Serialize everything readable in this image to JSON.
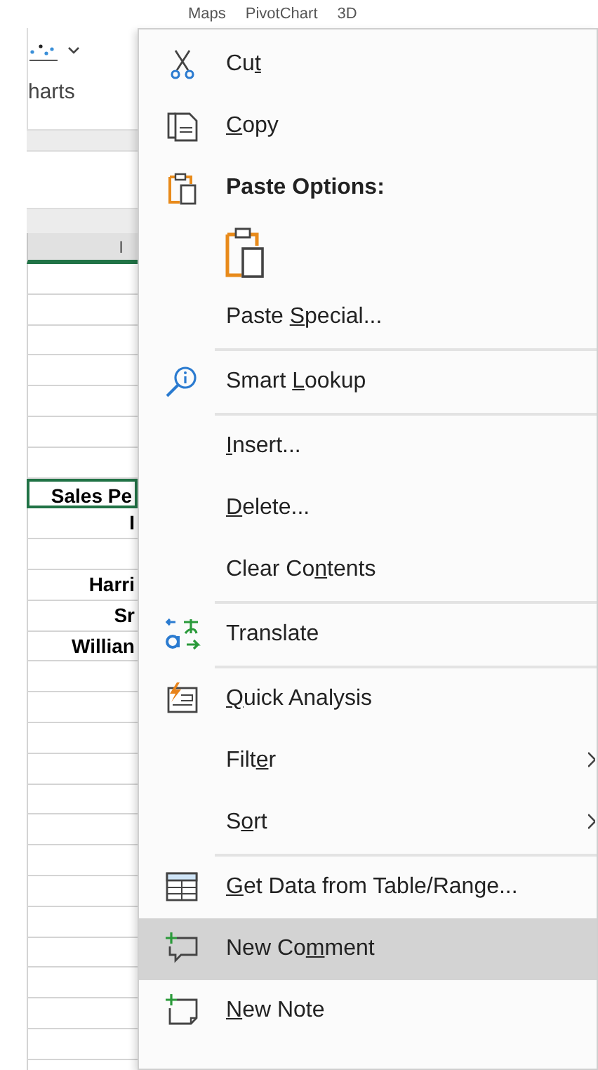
{
  "ribbon": {
    "top_labels": [
      "Maps",
      "PivotChart",
      "3D"
    ],
    "group_label": "harts"
  },
  "sheet": {
    "column_header": "I",
    "rows": [
      {
        "selected": false
      },
      {
        "selected": false
      },
      {
        "selected": false
      },
      {
        "selected": false
      },
      {
        "selected": false
      },
      {
        "selected": false
      },
      {
        "selected": false
      },
      {
        "value": "Sales Pe",
        "bold": true,
        "selected": true
      },
      {
        "value": "I",
        "bold": true,
        "selected": false
      },
      {
        "selected": false
      },
      {
        "value": "Harri",
        "bold": true,
        "selected": false
      },
      {
        "value": "Sr",
        "bold": true,
        "selected": false
      },
      {
        "value": "Willian",
        "bold": true,
        "selected": false
      },
      {
        "selected": false
      },
      {
        "selected": false
      },
      {
        "selected": false
      },
      {
        "selected": false
      },
      {
        "selected": false
      },
      {
        "selected": false
      },
      {
        "selected": false
      },
      {
        "selected": false
      },
      {
        "selected": false
      },
      {
        "selected": false
      },
      {
        "selected": false
      },
      {
        "selected": false
      },
      {
        "selected": false
      },
      {
        "selected": false
      }
    ]
  },
  "context_menu": {
    "items": [
      {
        "kind": "item",
        "before": "Cu",
        "key": "t",
        "selected": false
      },
      {
        "kind": "item",
        "key": "C",
        "after": "opy",
        "selected": false
      },
      {
        "kind": "heading",
        "label": "Paste Options:"
      },
      {
        "kind": "paste-option"
      },
      {
        "kind": "item",
        "before": "Paste ",
        "key": "S",
        "after": "pecial...",
        "selected": false
      },
      {
        "kind": "separator"
      },
      {
        "kind": "item",
        "before": "Smart ",
        "key": "L",
        "after": "ookup",
        "selected": false
      },
      {
        "kind": "separator"
      },
      {
        "kind": "item",
        "key": "I",
        "after": "nsert...",
        "selected": false
      },
      {
        "kind": "item",
        "key": "D",
        "after": "elete...",
        "selected": false
      },
      {
        "kind": "item",
        "before": "Clear Co",
        "key": "n",
        "after": "tents",
        "selected": false
      },
      {
        "kind": "separator"
      },
      {
        "kind": "item",
        "before": "Translate",
        "selected": false
      },
      {
        "kind": "separator"
      },
      {
        "kind": "item",
        "key": "Q",
        "after": "uick Analysis",
        "selected": false
      },
      {
        "kind": "item",
        "before": "Filt",
        "key": "e",
        "after": "r",
        "submenu": true,
        "selected": false
      },
      {
        "kind": "item",
        "before": "S",
        "key": "o",
        "after": "rt",
        "submenu": true,
        "selected": false
      },
      {
        "kind": "separator"
      },
      {
        "kind": "item",
        "key": "G",
        "after": "et Data from Table/Range...",
        "selected": false
      },
      {
        "kind": "item",
        "before": "New Co",
        "key": "m",
        "after": "ment",
        "selected": true
      },
      {
        "kind": "item",
        "key": "N",
        "after": "ew Note",
        "selected": false
      }
    ]
  }
}
